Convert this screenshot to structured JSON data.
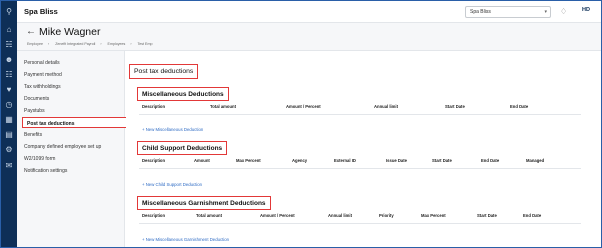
{
  "app": {
    "brand": "Spa Bliss"
  },
  "topbar": {
    "company_select": "Spa Bliss",
    "avatar_initials": "HD"
  },
  "employee": {
    "name": "Mike Wagner"
  },
  "breadcrumbs": [
    "Employee",
    "Zenefit Integrated Payroll",
    "Employees",
    "Test Emp"
  ],
  "sidebar": {
    "items": [
      {
        "label": "Personal details"
      },
      {
        "label": "Payment method"
      },
      {
        "label": "Tax withholdings"
      },
      {
        "label": "Documents"
      },
      {
        "label": "Paystubs"
      },
      {
        "label": "Post tax deductions",
        "active": true
      },
      {
        "label": "Benefits"
      },
      {
        "label": "Company defined employee set up"
      },
      {
        "label": "W2/1099 form"
      },
      {
        "label": "Notification settings"
      }
    ]
  },
  "main": {
    "page_title": "Post tax deductions",
    "sections": [
      {
        "title": "Miscellaneous Deductions",
        "columns": [
          "Description",
          "Total amount",
          "Amount / Percent",
          "Annual limit",
          "Start Date",
          "End Date"
        ],
        "add_link": "+ New Miscellaneous Deduction"
      },
      {
        "title": "Child Support Deductions",
        "columns": [
          "Description",
          "Amount",
          "Max Percent",
          "Agency",
          "External ID",
          "Issue Date",
          "Start Date",
          "End Date",
          "Managed"
        ],
        "add_link": "+ New Child Support Deduction"
      },
      {
        "title": "Miscellaneous Garnishment Deductions",
        "columns": [
          "Description",
          "Total amount",
          "Amount / Percent",
          "Annual limit",
          "Priority",
          "Max Percent",
          "Start Date",
          "End Date"
        ],
        "add_link": "+ New Miscellaneous Garnishment Deduction"
      }
    ]
  },
  "icons": {
    "rail": [
      "search-icon",
      "home-icon",
      "org-chart-icon",
      "people-icon",
      "payroll-icon",
      "benefits-icon",
      "time-icon",
      "calendar-icon",
      "reports-icon",
      "settings-icon",
      "chat-icon"
    ],
    "bell": "bell-icon",
    "back": "arrow-left-icon"
  },
  "colors": {
    "rail": "#0e2f57",
    "highlight": "#e23838",
    "link": "#2e6bc4"
  }
}
